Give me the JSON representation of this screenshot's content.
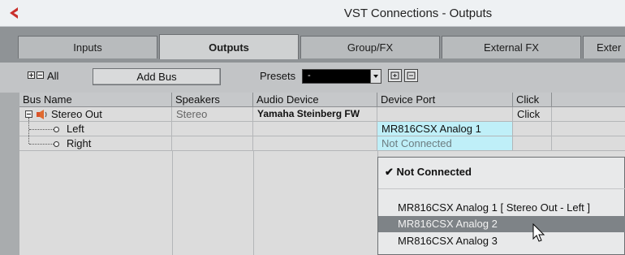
{
  "window": {
    "title": "VST Connections - Outputs"
  },
  "tabs": [
    {
      "label": "Inputs"
    },
    {
      "label": "Outputs"
    },
    {
      "label": "Group/FX"
    },
    {
      "label": "External FX"
    },
    {
      "label": "Exter"
    }
  ],
  "toolbar": {
    "all_label": "All",
    "add_bus_label": "Add Bus",
    "presets_label": "Presets",
    "presets_value": "-"
  },
  "table": {
    "columns": [
      "Bus Name",
      "Speakers",
      "Audio Device",
      "Device Port",
      "Click"
    ],
    "rows": [
      {
        "bus_name": "Stereo Out",
        "speakers": "Stereo",
        "audio_device": "Yamaha Steinberg FW",
        "device_port": "",
        "click": "Click"
      },
      {
        "bus_name": "Left",
        "speakers": "",
        "audio_device": "",
        "device_port": "MR816CSX Analog 1",
        "click": ""
      },
      {
        "bus_name": "Right",
        "speakers": "",
        "audio_device": "",
        "device_port": "Not Connected",
        "click": ""
      }
    ]
  },
  "dropdown": {
    "checked_item": "Not Connected",
    "options": [
      "MR816CSX Analog 1  [ Stereo Out - Left ]",
      "MR816CSX Analog 2",
      "MR816CSX Analog 3"
    ],
    "highlighted_option": "MR816CSX Analog 2"
  },
  "colors": {
    "accent_red": "#c9302c",
    "port_cell_bg": "#bfeff8",
    "highlight": "#7e8387",
    "presets_bg": "#000000"
  }
}
